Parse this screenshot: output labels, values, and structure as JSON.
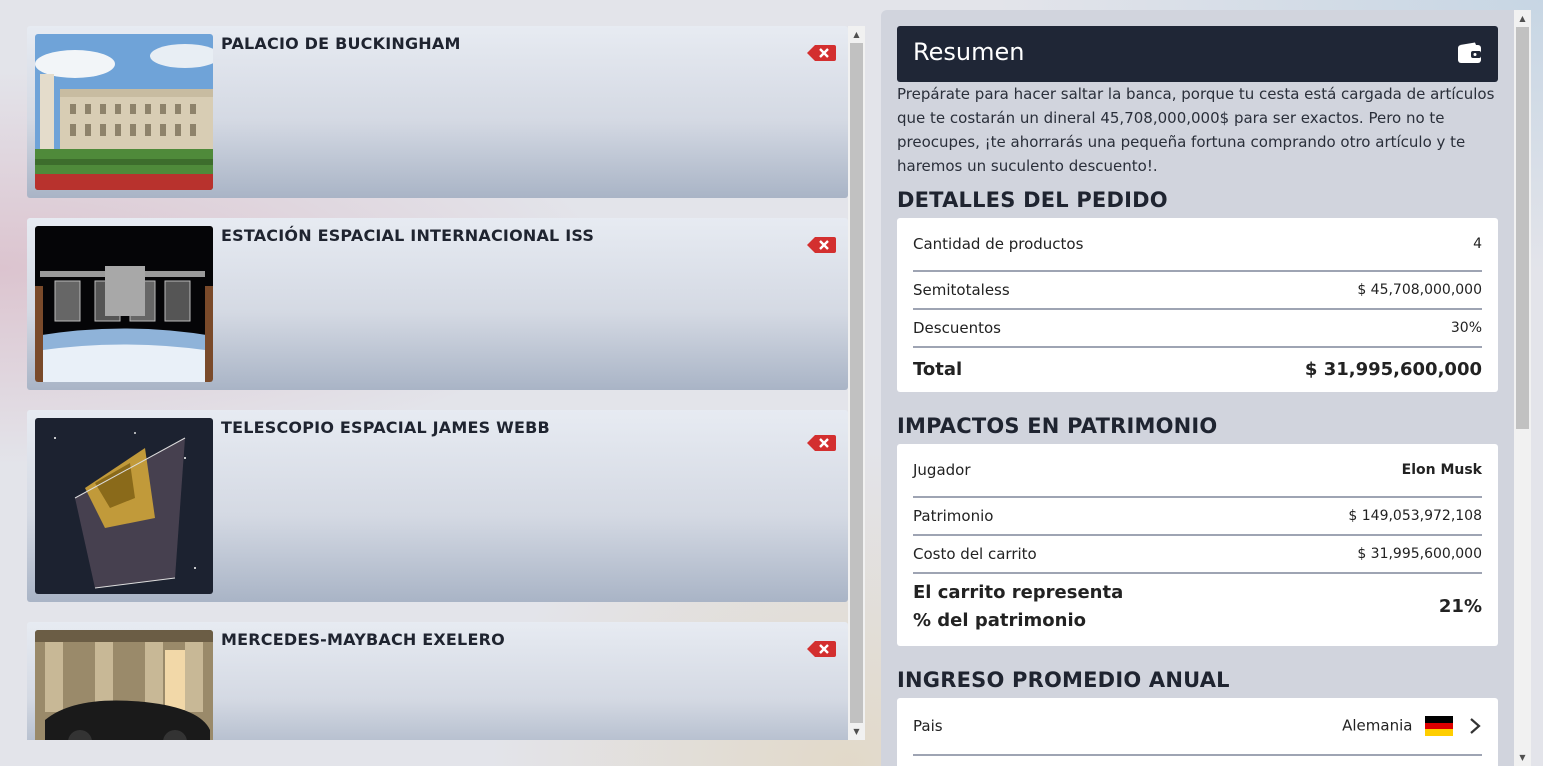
{
  "cart": {
    "items": [
      {
        "title": "PALACIO DE BUCKINGHAM",
        "image": "buckingham-palace-photo"
      },
      {
        "title": "ESTACIÓN ESPACIAL INTERNACIONAL ISS",
        "image": "iss-photo"
      },
      {
        "title": "TELESCOPIO ESPACIAL JAMES WEBB",
        "image": "james-webb-photo"
      },
      {
        "title": "MERCEDES-MAYBACH EXELERO",
        "image": "maybach-exelero-photo"
      }
    ],
    "remove_icon": "remove-x-icon"
  },
  "summary": {
    "title": "Resumen",
    "icon": "wallet-icon",
    "text": "Prepárate para hacer saltar la banca, porque tu cesta está cargada de artículos que te costarán un dineral 45,708,000,000$ para ser exactos. Pero no te preocupes, ¡te ahorrarás una pequeña fortuna comprando otro artículo y te haremos un suculento descuento!."
  },
  "order_details": {
    "title": "DETALLES DEL PEDIDO",
    "rows": [
      {
        "label": "Cantidad de productos",
        "value": "4"
      },
      {
        "label": "Semitotaless",
        "value": "$ 45,708,000,000"
      },
      {
        "label": "Descuentos",
        "value": "30%"
      },
      {
        "label": "Total",
        "value": "$ 31,995,600,000"
      }
    ]
  },
  "wealth_impact": {
    "title": "IMPACTOS EN PATRIMONIO",
    "rows": [
      {
        "label": "Jugador",
        "value": "Elon Musk"
      },
      {
        "label": "Patrimonio",
        "value": "$ 149,053,972,108"
      },
      {
        "label": "Costo del carrito",
        "value": "$ 31,995,600,000"
      },
      {
        "label_line1": "El carrito representa",
        "label_line2": "% del patrimonio",
        "value": "21%"
      }
    ]
  },
  "annual_income": {
    "title": "INGRESO PROMEDIO ANUAL",
    "rows": [
      {
        "label": "Pais",
        "value": "Alemania",
        "flag": "germany-flag-icon",
        "chevron": "chevron-right-icon"
      }
    ]
  },
  "colors": {
    "header_bg": "#1f2636",
    "remove_red": "#d32f2f",
    "panel_bg": "#d1d4dd"
  }
}
